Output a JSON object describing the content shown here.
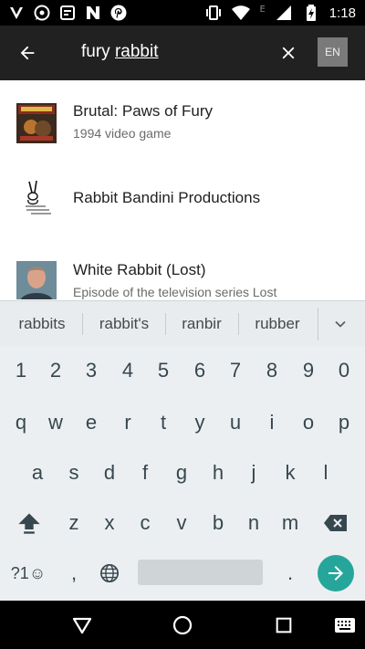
{
  "status_bar": {
    "left_icons": [
      "v-icon",
      "whatsapp-icon",
      "message-icon",
      "n-icon",
      "pinterest-icon"
    ],
    "right_icons": [
      "vibrate-icon",
      "wifi-icon",
      "signal-icon",
      "battery-charging-icon"
    ],
    "network_letter": "E",
    "time": "1:18"
  },
  "search": {
    "query_prefix": "fury ",
    "query_underlined": "rabbit",
    "language": "EN"
  },
  "results": [
    {
      "title": "Brutal: Paws of Fury",
      "subtitle": "1994 video game"
    },
    {
      "title": "Rabbit Bandini Productions",
      "subtitle": ""
    },
    {
      "title": "White Rabbit (Lost)",
      "subtitle": "Episode of the television series Lost"
    }
  ],
  "suggestions": [
    "rabbits",
    "rabbit's",
    "ranbir",
    "rubber"
  ],
  "keyboard": {
    "row_numbers": [
      "1",
      "2",
      "3",
      "4",
      "5",
      "6",
      "7",
      "8",
      "9",
      "0"
    ],
    "row1": [
      "q",
      "w",
      "e",
      "r",
      "t",
      "y",
      "u",
      "i",
      "o",
      "p"
    ],
    "row2": [
      "a",
      "s",
      "d",
      "f",
      "g",
      "h",
      "j",
      "k",
      "l"
    ],
    "row3": [
      "z",
      "x",
      "c",
      "v",
      "b",
      "n",
      "m"
    ],
    "symbols_label": "?1☺",
    "comma": ",",
    "period": ".",
    "enter_color": "#26a69a"
  },
  "nav": [
    "back-icon",
    "home-icon",
    "recents-icon",
    "keyboard-icon"
  ]
}
